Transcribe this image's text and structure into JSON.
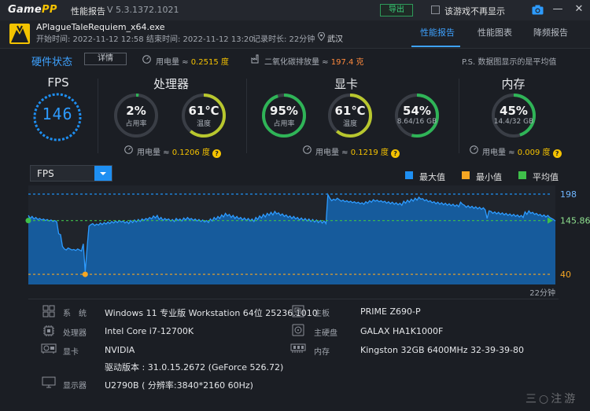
{
  "titlebar": {
    "brand_part1": "Game",
    "brand_part2": "PP",
    "title": "性能报告",
    "version": "V 5.3.1372.1021",
    "export_label": "导出",
    "dont_show_label": "该游戏不再显示",
    "minimize": "—",
    "close": "✕"
  },
  "header": {
    "game_name": "APlagueTaleRequiem_x64.exe",
    "start_time": "开始时间: 2022-11-12 12:58",
    "end_time": "结束时间: 2022-11-12 13:20",
    "duration": "记录时长: 22分钟",
    "location": "武汉",
    "tabs": [
      "性能报告",
      "性能图表",
      "降频报告"
    ]
  },
  "hardware": {
    "title": "硬件状态",
    "detail_label": "详情",
    "power_prefix": "用电量 ≈",
    "total_power": "0.2515 度",
    "co2_prefix": "二氧化碳排放量 ≈",
    "co2": "197.4 克",
    "ps_note": "P.S. 数据图显示的是平均值"
  },
  "fps": {
    "title": "FPS",
    "value": "146"
  },
  "cpu": {
    "title": "处理器",
    "usage_value": "2%",
    "usage_label": "占用率",
    "usage_fraction": 0.02,
    "temp_value": "61℃",
    "temp_label": "温度",
    "temp_fraction": 0.61,
    "power": "0.1206 度"
  },
  "gpu": {
    "title": "显卡",
    "usage_value": "95%",
    "usage_label": "占用率",
    "usage_fraction": 0.95,
    "temp_value": "61℃",
    "temp_label": "温度",
    "temp_fraction": 0.61,
    "mem_value": "54%",
    "mem_label": "8.64/16 GB",
    "mem_fraction": 0.54,
    "power": "0.1219 度"
  },
  "memory": {
    "title": "内存",
    "usage_value": "45%",
    "usage_label": "14.4/32 GB",
    "usage_fraction": 0.45,
    "power": "0.009 度"
  },
  "chart": {
    "metric_select": "FPS",
    "legend": [
      "最大值",
      "最小值",
      "平均值"
    ],
    "colors": {
      "max": "#1e8ff2",
      "min": "#f5a623",
      "avg": "#3fbf4a",
      "fill": "#1565b0",
      "line": "#2d9bff"
    }
  },
  "chart_data": {
    "type": "area",
    "x_end_label": "22分钟",
    "max": 198,
    "min": 40,
    "avg": 145.86,
    "ylim": [
      20,
      215
    ],
    "max_label": "198",
    "min_label": "40",
    "avg_label": "145.86",
    "series": [
      {
        "values": [
          156,
          150,
          154,
          149,
          152,
          148,
          150,
          147,
          149,
          146,
          148,
          145,
          147,
          144,
          146,
          143,
          120,
          118,
          95,
          90,
          88,
          92,
          90,
          88,
          89,
          87,
          90,
          88,
          86,
          100,
          45,
          92,
          135,
          138,
          140,
          136,
          139,
          137,
          141,
          138,
          142,
          139,
          143,
          140,
          144,
          141,
          145,
          142,
          146,
          143,
          145,
          141,
          144,
          140,
          146,
          142,
          147,
          143,
          148,
          144,
          149,
          146,
          150,
          148,
          152,
          149,
          155,
          151,
          156,
          148,
          152,
          146,
          150,
          147,
          149,
          145,
          148,
          144,
          150,
          146,
          149,
          145,
          151,
          147,
          152,
          148,
          150,
          146,
          149,
          145,
          148,
          144,
          147,
          143,
          146,
          142,
          149,
          145,
          152,
          148,
          154,
          150,
          157,
          153,
          160,
          155,
          158,
          152,
          156,
          150,
          154,
          149,
          152,
          147,
          151,
          146,
          150,
          145,
          149,
          144,
          152,
          148,
          155,
          151,
          158,
          153,
          160,
          156,
          162,
          157,
          164,
          159,
          161,
          156,
          159,
          154,
          157,
          152,
          155,
          150,
          154,
          149,
          152,
          147,
          151,
          146,
          150,
          145,
          149,
          144,
          148,
          143,
          147,
          142,
          146,
          141,
          145,
          140,
          197,
          190,
          185,
          188,
          186,
          190,
          187,
          184,
          186,
          183,
          185,
          182,
          184,
          181,
          183,
          180,
          182,
          179,
          181,
          178,
          183,
          180,
          185,
          182,
          187,
          184,
          186,
          183,
          185,
          182,
          184,
          180,
          183,
          179,
          182,
          178,
          181,
          177,
          180,
          176,
          184,
          180,
          186,
          182,
          188,
          184,
          190,
          186,
          192,
          188,
          189,
          185,
          187,
          183,
          185,
          181,
          183,
          179,
          182,
          178,
          181,
          177,
          180,
          176,
          179,
          175,
          178,
          174,
          177,
          173,
          182,
          178,
          176,
          172,
          175,
          171,
          174,
          170,
          173,
          169,
          172,
          168,
          171,
          167,
          150,
          165,
          164,
          160,
          163,
          159,
          162,
          158,
          161,
          157,
          160,
          156,
          159,
          155,
          158,
          154,
          157,
          153,
          156,
          152,
          163,
          158,
          165,
          160,
          162,
          158,
          160,
          156,
          158,
          154,
          157,
          153,
          156,
          152,
          150,
          148,
          145
        ]
      }
    ]
  },
  "system": {
    "os_key": "系　统",
    "os": "Windows 11 专业版 Workstation 64位 25236.1010",
    "cpu_key": "处理器",
    "cpu": "Intel Core i7-12700K",
    "gpu_key": "显卡",
    "gpu": "NVIDIA",
    "driver": "驱动版本 : 31.0.15.2672 (GeForce 526.72)",
    "monitor_key": "显示器",
    "monitor": "U2790B ( 分辨率:3840*2160 60Hz)",
    "board_key": "主板",
    "board": "PRIME Z690-P",
    "disk_key": "主硬盘",
    "disk": "GALAX HA1K1000F",
    "ram_key": "内存",
    "ram": "Kingston 32GB 6400MHz 32-39-39-80"
  },
  "watermark": "三○注游"
}
